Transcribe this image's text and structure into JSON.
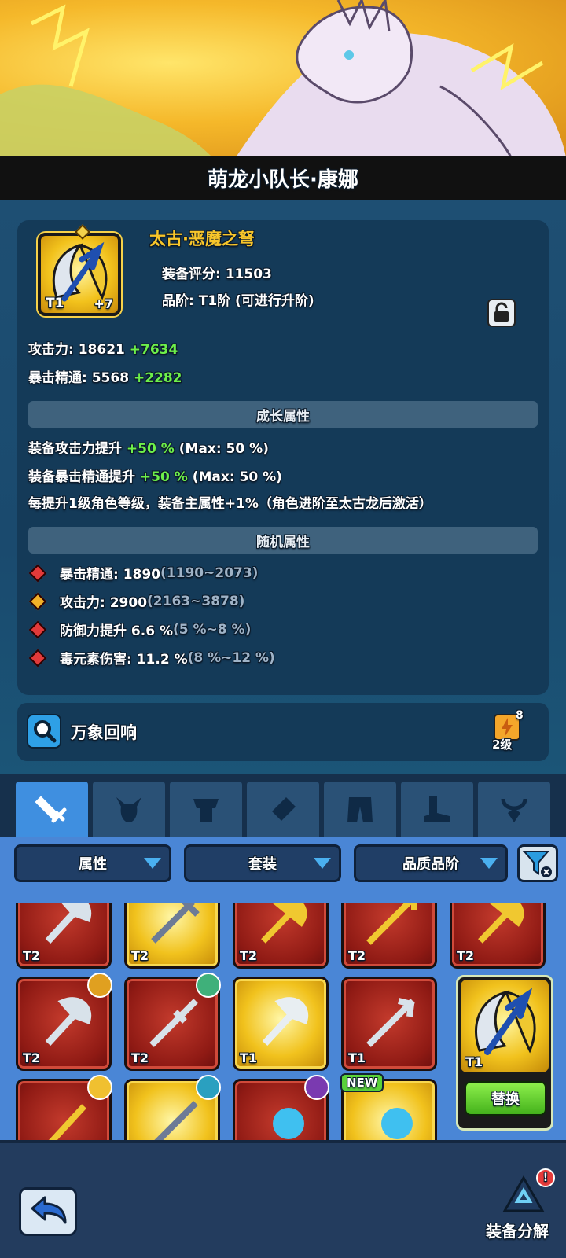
{
  "character": {
    "name": "萌龙小队长·康娜"
  },
  "equipment": {
    "name": "太古·恶魔之弩",
    "tier": "T1",
    "enhance": "+7",
    "score_line": "装备评分: 11503",
    "grade_line": "品阶: T1阶  (可进行升阶)",
    "stats": [
      {
        "label": "攻击力: 18621 ",
        "bonus": "+7634"
      },
      {
        "label": "暴击精通: 5568 ",
        "bonus": "+2282"
      }
    ],
    "growth_title": "成长属性",
    "growth": [
      {
        "label": "装备攻击力提升 ",
        "bonus": "+50 %",
        "max": " (Max: 50 %)"
      },
      {
        "label": "装备暴击精通提升 ",
        "bonus": "+50 %",
        "max": " (Max: 50 %)"
      },
      {
        "label": "每提升1级角色等级，装备主属性+1%（角色进阶至太古龙后激活）",
        "bonus": "",
        "max": ""
      }
    ],
    "random_title": "随机属性",
    "random": [
      {
        "label": "暴击精通: 1890 ",
        "range": "(1190~2073)",
        "color": "#e23a3a"
      },
      {
        "label": "攻击力: 2900 ",
        "range": "(2163~3878)",
        "color": "#f2b128"
      },
      {
        "label": "防御力提升 6.6 % ",
        "range": "(5 %~8 %)",
        "color": "#e23a3a"
      },
      {
        "label": "毒元素伤害: 11.2 % ",
        "range": "(8 %~12 %)",
        "color": "#e23a3a"
      }
    ]
  },
  "echo": {
    "label": "万象回响",
    "count": "8",
    "level": "2级"
  },
  "tabs": [
    {
      "icon": "sword-icon",
      "active": true
    },
    {
      "icon": "helmet-icon",
      "active": false
    },
    {
      "icon": "armor-icon",
      "active": false
    },
    {
      "icon": "bracer-icon",
      "active": false
    },
    {
      "icon": "pants-icon",
      "active": false
    },
    {
      "icon": "boots-icon",
      "active": false
    },
    {
      "icon": "necklace-icon",
      "active": false
    }
  ],
  "filters": {
    "attribute": "属性",
    "set": "套装",
    "quality": "品质品阶"
  },
  "inventory": [
    {
      "tier": "T2",
      "quality": "red"
    },
    {
      "tier": "T2",
      "quality": "gold"
    },
    {
      "tier": "T2",
      "quality": "red"
    },
    {
      "tier": "T2",
      "quality": "red"
    },
    {
      "tier": "T2",
      "quality": "red"
    },
    {
      "tier": "T2",
      "quality": "red"
    },
    {
      "tier": "T2",
      "quality": "red"
    },
    {
      "tier": "T1",
      "quality": "gold"
    },
    {
      "tier": "T1",
      "quality": "red"
    },
    {
      "tier": "T1",
      "quality": "gold"
    },
    {
      "tier": "",
      "quality": "red"
    },
    {
      "tier": "",
      "quality": "gold"
    },
    {
      "tier": "",
      "quality": "red"
    },
    {
      "tier": "",
      "quality": "gold"
    }
  ],
  "new_tag": "NEW",
  "replace_label": "替换",
  "dismantle": {
    "label": "装备分解",
    "alert": "!"
  },
  "colors": {
    "gold": "#f8c62a",
    "bonus_green": "#6df04a",
    "panel": "#143a58",
    "inventory_bg": "#4a86d6"
  }
}
